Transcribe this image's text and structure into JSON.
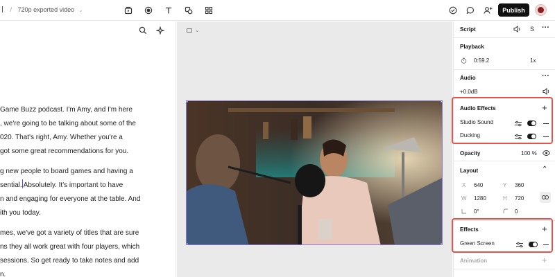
{
  "topbar": {
    "breadcrumb_sep": "/",
    "project_title": "720p exported video",
    "toolbar_icons": [
      "media-icon",
      "record-icon",
      "text-icon",
      "shapes-icon",
      "grid-icon"
    ],
    "right_icons": [
      "check-icon",
      "comment-icon",
      "add-user-icon"
    ],
    "publish_label": "Publish"
  },
  "transcript": {
    "paragraphs": [
      [
        "Game Buzz podcast. I'm Amy, and I'm here",
        ", we're going to be talking about some of the",
        "020. That's right, Amy. Whether you're a",
        "got some great recommendations for you."
      ],
      [
        "g new people to board games and having a",
        "sential.",
        "n and engaging for everyone at the table. And",
        "ith you today."
      ],
      [
        "mes, we've got a variety of titles that are sure",
        "ns they all work great with four players, which",
        "sessions. So get ready to take notes and add",
        "n."
      ]
    ],
    "caret_after_text": "Absolutely. It's important to have"
  },
  "panel": {
    "script": {
      "title": "Script",
      "speaker_initial": "S"
    },
    "playback": {
      "title": "Playback",
      "time": "0:59.2",
      "speed": "1x"
    },
    "audio": {
      "title": "Audio",
      "volume": "+0.0dB"
    },
    "audio_effects": {
      "title": "Audio Effects",
      "items": [
        "Studio Sound",
        "Ducking"
      ]
    },
    "opacity": {
      "label": "Opacity",
      "value": "100 %"
    },
    "layout": {
      "title": "Layout",
      "x_label": "X",
      "x_value": "640",
      "y_label": "Y",
      "y_value": "360",
      "w_label": "W",
      "w_value": "1280",
      "h_label": "H",
      "h_value": "720",
      "rotation": "0°",
      "corner": "0"
    },
    "effects": {
      "title": "Effects",
      "items": [
        "Green Screen"
      ]
    },
    "animation": {
      "title": "Animation"
    }
  },
  "colors": {
    "accent": "#8c79d6",
    "highlight": "#e8524a",
    "publish_bg": "#111111"
  }
}
